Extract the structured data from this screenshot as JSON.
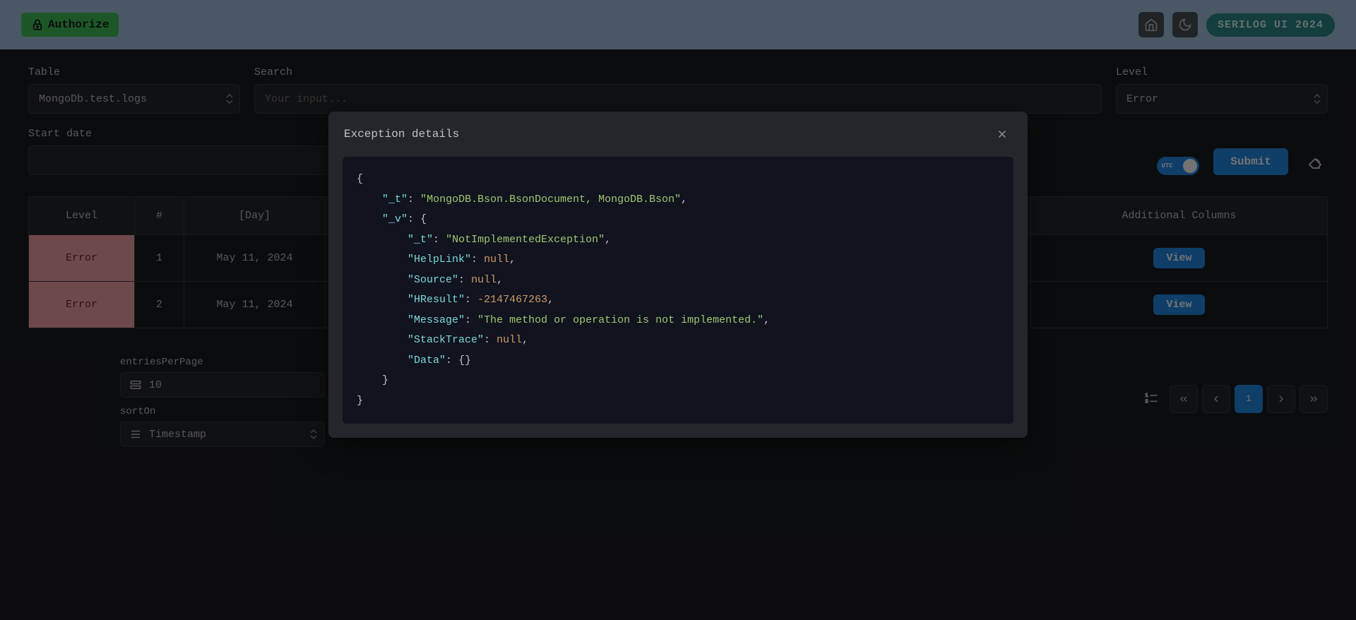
{
  "header": {
    "authorize_label": "Authorize",
    "brand_label": "SERILOG UI 2024"
  },
  "filters": {
    "table_label": "Table",
    "table_value": "MongoDb.test.logs",
    "search_label": "Search",
    "search_placeholder": "Your input...",
    "level_label": "Level",
    "level_value": "Error",
    "start_date_label": "Start date",
    "utc_label": "UTC",
    "submit_label": "Submit"
  },
  "table": {
    "headers": {
      "level": "Level",
      "num": "#",
      "day": "[Day]",
      "additional": "Additional Columns"
    },
    "rows": [
      {
        "level": "Error",
        "num": "1",
        "day": "May 11, 2024",
        "view_label": "View"
      },
      {
        "level": "Error",
        "num": "2",
        "day": "May 11, 2024",
        "view_label": "View"
      }
    ]
  },
  "bottom": {
    "entries_label": "entriesPerPage",
    "entries_value": "10",
    "sort_label": "sortOn",
    "sort_value": "Timestamp"
  },
  "pagination": {
    "current": "1"
  },
  "modal": {
    "title": "Exception details",
    "exception": {
      "_t": "MongoDB.Bson.BsonDocument, MongoDB.Bson",
      "_v": {
        "_t": "NotImplementedException",
        "HelpLink": null,
        "Source": null,
        "HResult": -2147467263,
        "Message": "The method or operation is not implemented.",
        "StackTrace": null,
        "Data": {}
      }
    }
  }
}
